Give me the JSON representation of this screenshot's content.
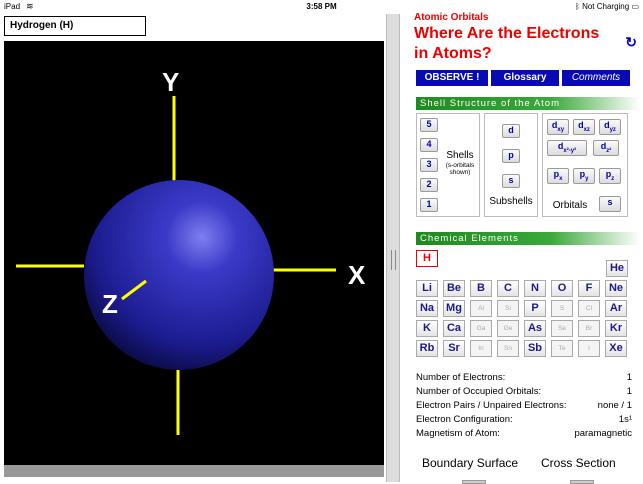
{
  "status": {
    "carrier": "iPad",
    "time": "3:58 PM",
    "battery": "Not Charging"
  },
  "atom_title": "Hydrogen (H)",
  "axes": {
    "y": "Y",
    "x": "X",
    "z": "Z"
  },
  "panel": {
    "subtitle": "Atomic Orbitals",
    "title": "Where Are the Electrons in Atoms?"
  },
  "tabs": [
    "OBSERVE !",
    "Glossary",
    "Comments"
  ],
  "shell_section": "Shell Structure of the Atom",
  "shells": [
    "5",
    "4",
    "3",
    "2",
    "1"
  ],
  "shells_label": "Shells",
  "shells_note": "(s-orbitals shown)",
  "subshells": [
    "d",
    "p",
    "s"
  ],
  "subshells_label": "Subshells",
  "orbitals": [
    [
      "d",
      "xy"
    ],
    [
      "d",
      "xz"
    ],
    [
      "d",
      "yz"
    ],
    [
      "d",
      "x²-y²"
    ],
    [
      "d",
      "z²"
    ],
    [
      "p",
      "x"
    ],
    [
      "p",
      "y"
    ],
    [
      "p",
      "z"
    ],
    [
      "s",
      ""
    ]
  ],
  "orbitals_label": "Orbitals",
  "elements_section": "Chemical Elements",
  "elements": [
    [
      "H",
      "He"
    ],
    [
      "Li",
      "Be",
      "B",
      "C",
      "N",
      "O",
      "F",
      "Ne"
    ],
    [
      "Na",
      "Mg",
      "Al",
      "Si",
      "P",
      "S",
      "Cl",
      "Ar"
    ],
    [
      "K",
      "Ca",
      "Ga",
      "Ge",
      "As",
      "Se",
      "Br",
      "Kr"
    ],
    [
      "Rb",
      "Sr",
      "In",
      "Sn",
      "Sb",
      "Te",
      "I",
      "Xe"
    ]
  ],
  "dimmed": [
    "Al",
    "Si",
    "S",
    "Cl",
    "Ga",
    "Ge",
    "Se",
    "Br",
    "In",
    "Sn",
    "Te",
    "I"
  ],
  "info": [
    {
      "label": "Number of Electrons:",
      "value": "1"
    },
    {
      "label": "Number of Occupied Orbitals:",
      "value": "1"
    },
    {
      "label": "Electron Pairs / Unpaired Electrons:",
      "value": "none / 1"
    },
    {
      "label": "Electron Configuration:",
      "value": "1s¹"
    },
    {
      "label": "Magnetism of Atom:",
      "value": "paramagnetic"
    }
  ],
  "bottom": {
    "left": "Boundary Surface",
    "right": "Cross Section"
  },
  "colors": {
    "accent": "#0a0ab4",
    "title": "#e00000",
    "sphere": "#2a2aa8",
    "axis": "#ffff00",
    "section": "#1f8a1f"
  }
}
